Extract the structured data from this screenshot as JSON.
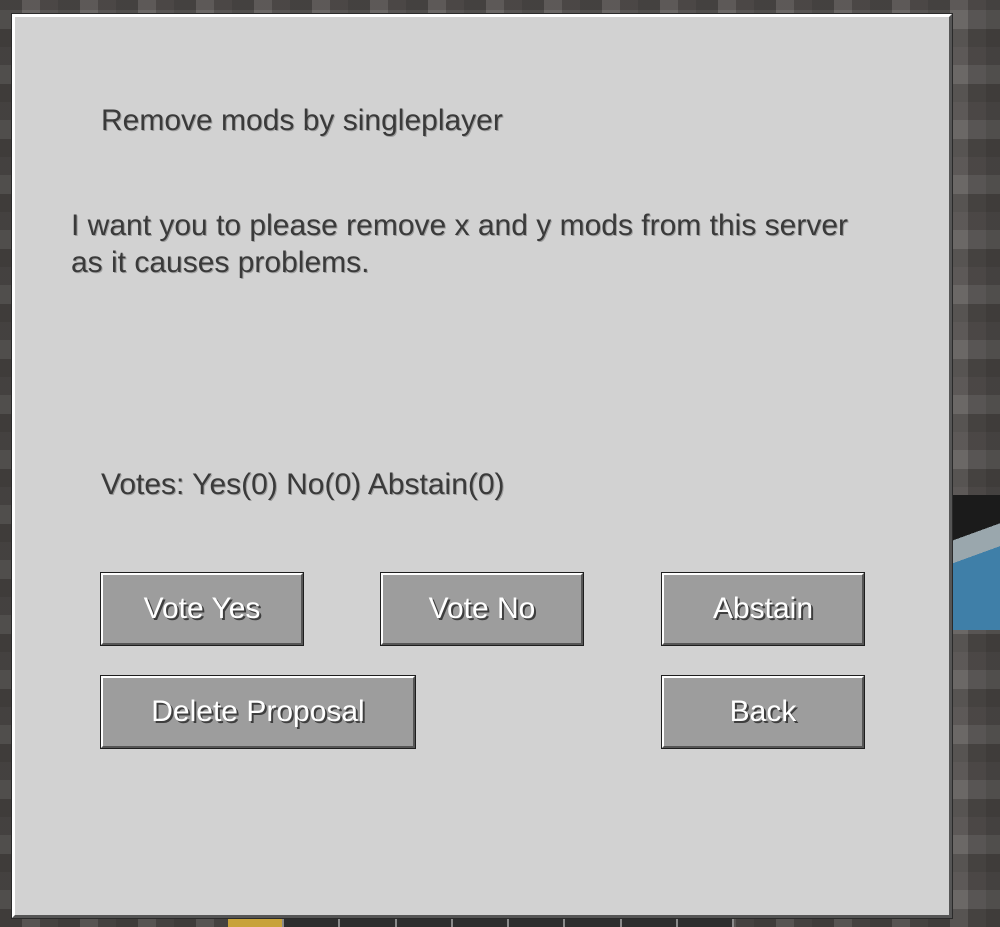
{
  "proposal": {
    "title": "Remove mods by singleplayer",
    "body": "I want you to please remove x and y mods from this server as it causes problems.",
    "votes_text": "Votes: Yes(0) No(0) Abstain(0)"
  },
  "buttons": {
    "vote_yes": "Vote Yes",
    "vote_no": "Vote No",
    "abstain": "Abstain",
    "delete_proposal": "Delete Proposal",
    "back": "Back"
  },
  "colors": {
    "panel": "#d2d2d2",
    "button": "#9d9d9d",
    "text": "#3a3a3a",
    "button_text": "#ffffff"
  }
}
